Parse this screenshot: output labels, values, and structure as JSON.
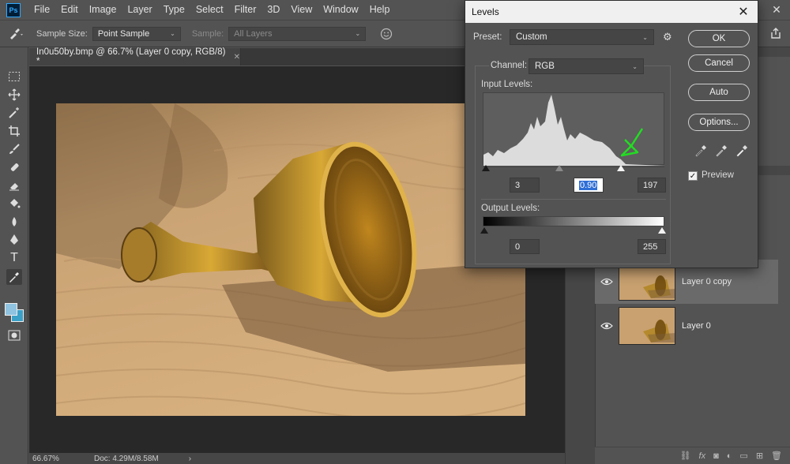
{
  "app": {
    "logo_text": "Ps",
    "menu": [
      "File",
      "Edit",
      "Image",
      "Layer",
      "Type",
      "Select",
      "Filter",
      "3D",
      "View",
      "Window",
      "Help"
    ]
  },
  "options_bar": {
    "sample_size_label": "Sample Size:",
    "sample_size_value": "Point Sample",
    "sample_label": "Sample:",
    "sample_value": "All Layers"
  },
  "document": {
    "tab_title": "In0u50by.bmp @ 66.7% (Layer 0 copy, RGB/8) *",
    "zoom": "66.67%",
    "doc_size": "Doc: 4.29M/8.58M"
  },
  "layers": [
    {
      "name": "Layer 0 copy",
      "selected": true,
      "visible": true
    },
    {
      "name": "Layer 0",
      "selected": false,
      "visible": true
    }
  ],
  "levels_dialog": {
    "title": "Levels",
    "preset_label": "Preset:",
    "preset_value": "Custom",
    "channel_label": "Channel:",
    "channel_value": "RGB",
    "input_levels_label": "Input Levels:",
    "input_black": "3",
    "input_gamma": "0.90",
    "input_white": "197",
    "output_levels_label": "Output Levels:",
    "output_black": "0",
    "output_white": "255",
    "buttons": {
      "ok": "OK",
      "cancel": "Cancel",
      "auto": "Auto",
      "options": "Options..."
    },
    "preview_label": "Preview",
    "preview_checked": true
  },
  "colors": {
    "ui_bg": "#535353",
    "canvas_bg": "#282828",
    "annotation_arrow": "#22dd22",
    "highlight": "#2f6fd6"
  }
}
